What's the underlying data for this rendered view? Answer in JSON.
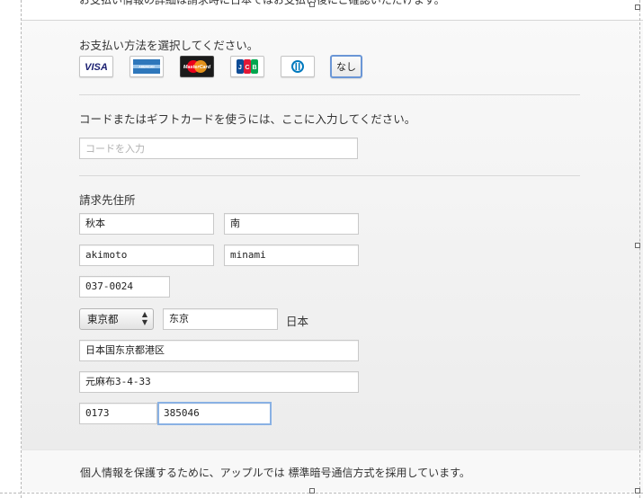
{
  "top_text": "お支払い情報の詳細は請求時に日本ではお支払い後にご確認いただけます。",
  "payment": {
    "heading": "お支払い方法を選択してください。",
    "cards": [
      {
        "name": "visa-card-icon",
        "label": "VISA",
        "color": "#1a1f71"
      },
      {
        "name": "amex-card-icon",
        "label": "AMERICAN EXPRESS",
        "color": "#2e77bb"
      },
      {
        "name": "mastercard-card-icon",
        "label": "MasterCard",
        "color": "#eb001b"
      },
      {
        "name": "jcb-card-icon",
        "label": "JCB",
        "color": "#0e4c96"
      },
      {
        "name": "diners-card-icon",
        "label": "Diners",
        "color": "#0079be"
      }
    ],
    "none_label": "なし"
  },
  "code": {
    "heading": "コードまたはギフトカードを使うには、ここに入力してください。",
    "placeholder": "コードを入力"
  },
  "billing": {
    "heading": "請求先住所",
    "last_name": "秋本",
    "first_name": "南",
    "last_name_roman": "akimoto",
    "first_name_roman": "minami",
    "postal_code": "037-0024",
    "prefecture": "東京都",
    "city": "东京",
    "country": "日本",
    "address1": "日本国东京都港区",
    "address2": "元麻布3-4-33",
    "phone_area": "0173",
    "phone_number": "385046"
  },
  "footer": {
    "text": "個人情報を保護するために、アップルでは 標準暗号通信方式を採用しています。"
  }
}
